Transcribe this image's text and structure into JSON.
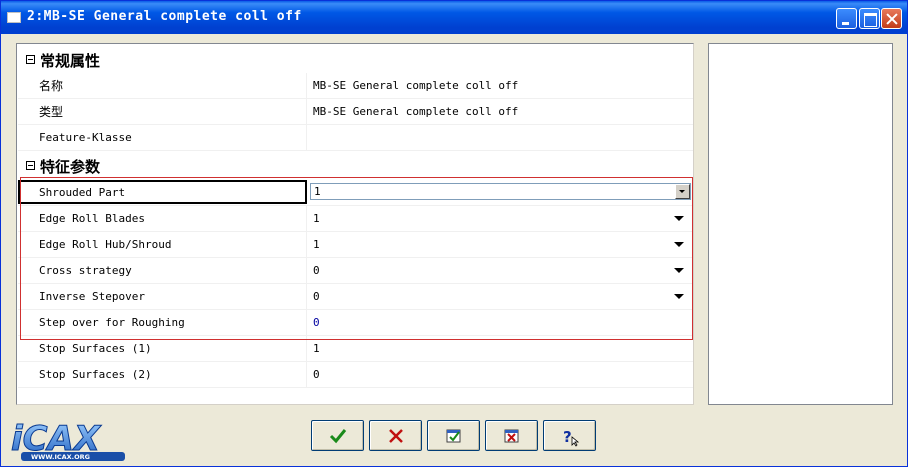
{
  "window": {
    "title": "2:MB-SE General complete coll off"
  },
  "general": {
    "header": "常规属性",
    "rows": [
      {
        "name": "名称",
        "value": "MB-SE General complete coll off"
      },
      {
        "name": "类型",
        "value": "MB-SE General complete coll off"
      },
      {
        "name": "Feature-Klasse",
        "value": ""
      }
    ]
  },
  "features": {
    "header": "特征参数",
    "rows": [
      {
        "name": "Shrouded Part",
        "value": "1"
      },
      {
        "name": "Edge Roll Blades",
        "value": "1"
      },
      {
        "name": "Edge Roll Hub/Shroud",
        "value": "1"
      },
      {
        "name": "Cross strategy",
        "value": "0"
      },
      {
        "name": "Inverse Stepover",
        "value": "0"
      },
      {
        "name": "Step over for Roughing",
        "value": "0"
      },
      {
        "name": "Stop Surfaces (1)",
        "value": "1"
      },
      {
        "name": "Stop Surfaces (2)",
        "value": "0"
      }
    ]
  },
  "buttons": [
    {
      "icon": "checkmark-icon"
    },
    {
      "icon": "cross-icon"
    },
    {
      "icon": "apply-icon"
    },
    {
      "icon": "cancel-doc-icon"
    },
    {
      "icon": "help-icon"
    }
  ],
  "logo": {
    "text": "iCAX",
    "url": "WWW.ICAX.ORG"
  },
  "colors": {
    "titlebar": "#0058e6",
    "highlight_border": "#d03030",
    "value_blue": "#0000a0"
  }
}
